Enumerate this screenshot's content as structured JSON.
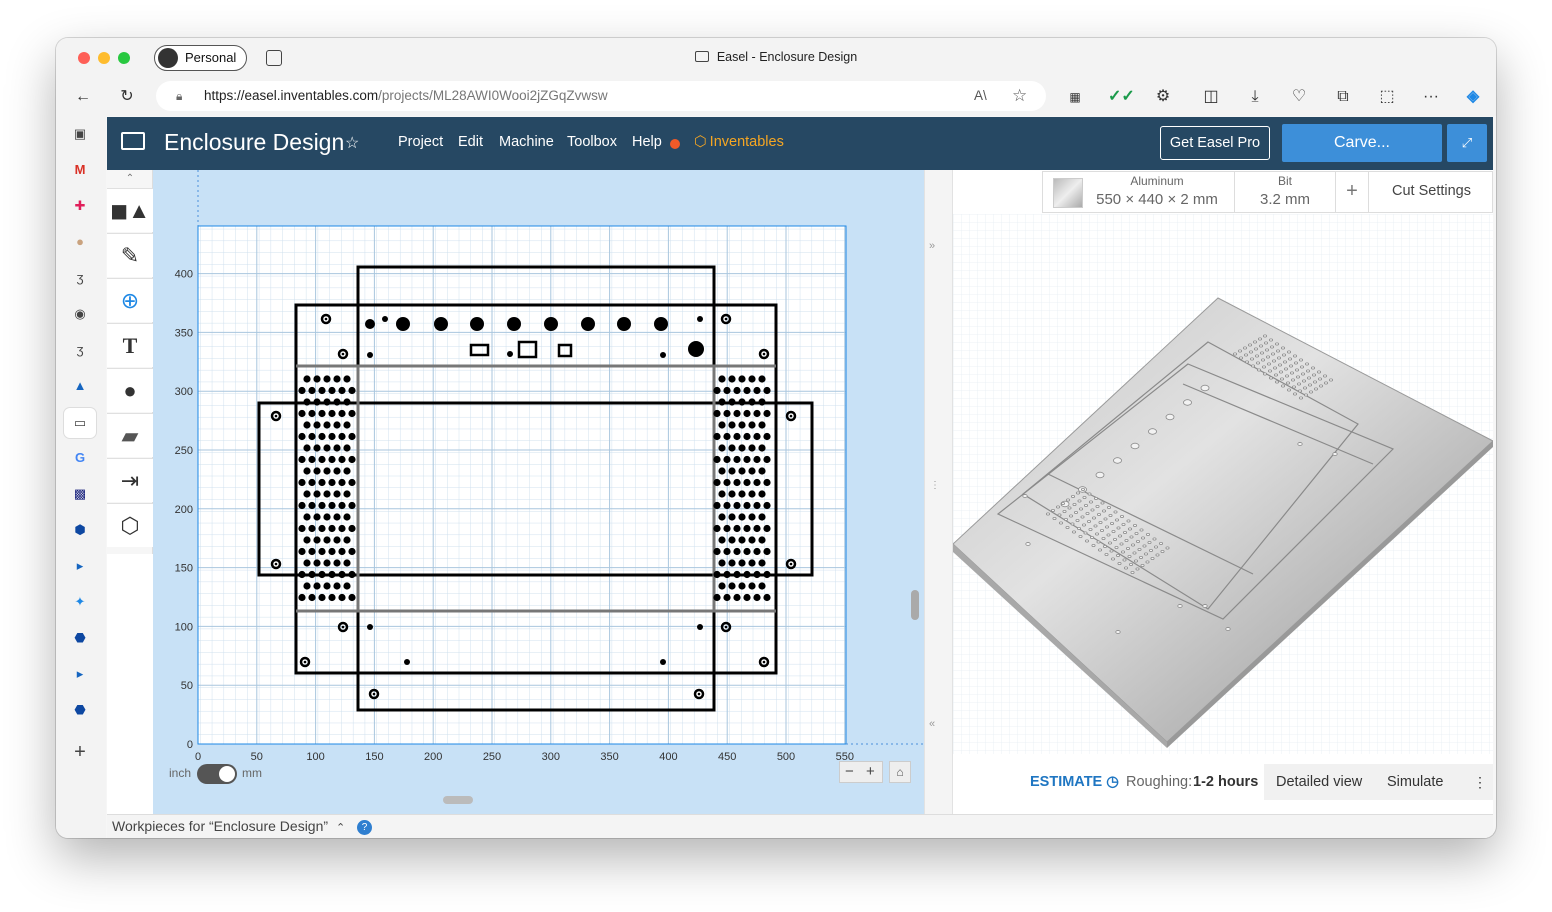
{
  "browser": {
    "profile_label": "Personal",
    "window_title": "Easel - Enclosure Design",
    "url_host": "https://easel.inventables.com",
    "url_path": "/projects/ML28AWI0Wooi2jZGqZvwsw"
  },
  "app": {
    "project_title": "Enclosure Design",
    "menu": [
      "Project",
      "Edit",
      "Machine",
      "Toolbox",
      "Help"
    ],
    "brand": "Inventables",
    "get_pro_label": "Get Easel Pro",
    "carve_label": "Carve..."
  },
  "canvas": {
    "y_ticks": [
      "400",
      "350",
      "300",
      "250",
      "200",
      "150",
      "100",
      "50",
      "0"
    ],
    "x_ticks": [
      "0",
      "50",
      "100",
      "150",
      "200",
      "250",
      "300",
      "350",
      "400",
      "450",
      "500",
      "550"
    ],
    "unit_left": "inch",
    "unit_right": "mm"
  },
  "cut_settings": {
    "material_label": "Aluminum",
    "material_size": "550 × 440 × 2 mm",
    "bit_label": "Bit",
    "bit_size": "3.2 mm",
    "cut_settings_label": "Cut Settings"
  },
  "estimate": {
    "label": "ESTIMATE",
    "roughing_label": "Roughing:",
    "roughing_value": "1-2 hours",
    "detailed_label": "Detailed view",
    "simulate_label": "Simulate"
  },
  "footer": {
    "workpieces_label": "Workpieces for “Enclosure Design”"
  },
  "colors": {
    "appbar": "#264863",
    "carve_button": "#3d8fd9",
    "canvas_bg": "#c8e1f6",
    "estimate_text": "#1f76c2",
    "help_dot": "#f05a28",
    "brand": "#f5a623"
  }
}
